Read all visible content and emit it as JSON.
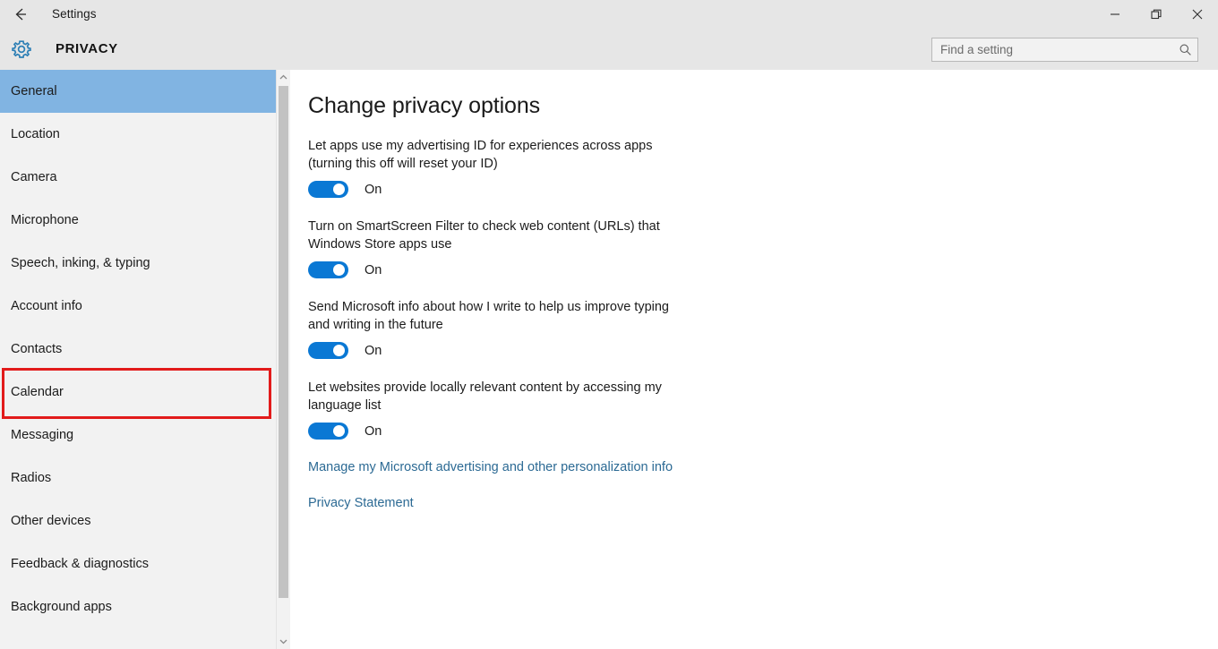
{
  "window": {
    "app_title": "Settings",
    "back_icon": "back-arrow-icon",
    "controls": [
      {
        "name": "minimize",
        "label": "Minimize"
      },
      {
        "name": "restore",
        "label": "Restore"
      },
      {
        "name": "close",
        "label": "Close"
      }
    ]
  },
  "header": {
    "icon": "gear-icon",
    "title": "PRIVACY",
    "search": {
      "placeholder": "Find a setting",
      "value": "",
      "icon": "search-icon"
    }
  },
  "sidebar": {
    "selected": "General",
    "highlighted": "Calendar",
    "items": [
      {
        "label": "General"
      },
      {
        "label": "Location"
      },
      {
        "label": "Camera"
      },
      {
        "label": "Microphone"
      },
      {
        "label": "Speech, inking, & typing"
      },
      {
        "label": "Account info"
      },
      {
        "label": "Contacts"
      },
      {
        "label": "Calendar"
      },
      {
        "label": "Messaging"
      },
      {
        "label": "Radios"
      },
      {
        "label": "Other devices"
      },
      {
        "label": "Feedback & diagnostics"
      },
      {
        "label": "Background apps"
      }
    ],
    "scrollbar": {
      "up_icon": "chevron-up-icon",
      "down_icon": "chevron-down-icon"
    }
  },
  "main": {
    "heading": "Change privacy options",
    "settings": [
      {
        "label": "Let apps use my advertising ID for experiences across apps (turning this off will reset your ID)",
        "state": "On",
        "enabled": true
      },
      {
        "label": "Turn on SmartScreen Filter to check web content (URLs) that Windows Store apps use",
        "state": "On",
        "enabled": true
      },
      {
        "label": "Send Microsoft info about how I write to help us improve typing and writing in the future",
        "state": "On",
        "enabled": true
      },
      {
        "label": "Let websites provide locally relevant content by accessing my language list",
        "state": "On",
        "enabled": true
      }
    ],
    "links": [
      {
        "label": "Manage my Microsoft advertising and other personalization info"
      },
      {
        "label": "Privacy Statement"
      }
    ]
  },
  "colors": {
    "accent": "#0a78d4",
    "selection": "#81b4e2",
    "highlight_box": "#e21b1b",
    "link": "#2c6a94",
    "chrome": "#e6e6e6",
    "sidebar": "#f2f2f2"
  }
}
